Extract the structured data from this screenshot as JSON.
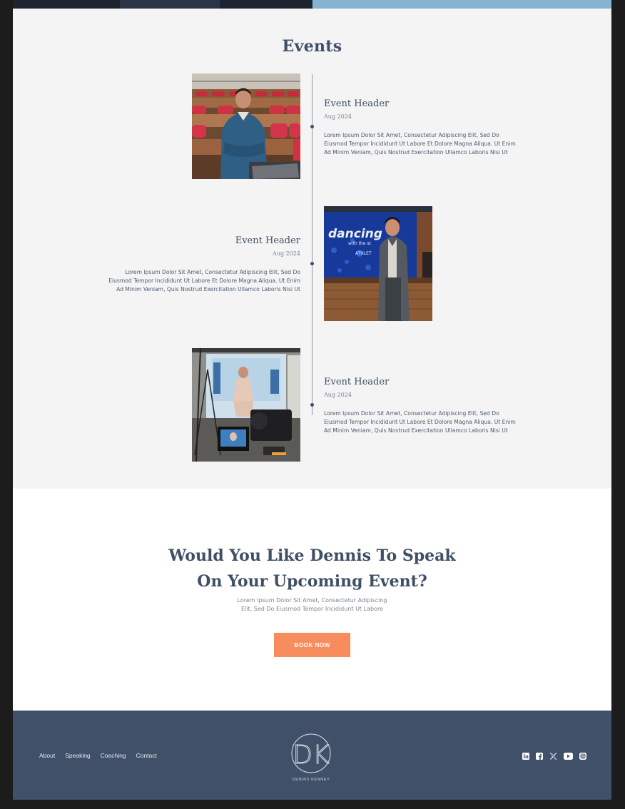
{
  "events": {
    "title": "Events",
    "items": [
      {
        "header": "Event Header",
        "date": "Aug 2024",
        "body_lines": [
          "Lorem Ipsum Dolor Sit Amet, Consectetur Adipiscing Elit, Sed Do",
          "Eiusmod Tempor Incididunt Ut Labore Et Dolore Magna Aliqua. Ut Enim",
          "Ad Minim Veniam, Quis Nostrud Exercitation Ullamco Laboris Nisi Ut"
        ]
      },
      {
        "header": "Event Header",
        "date": "Aug 2024",
        "body_lines": [
          "Lorem Ipsum Dolor Sit Amet, Consectetur Adipiscing Elit, Sed Do",
          "Eiusmod Tempor Incididunt Ut Labore Et Dolore Magna Aliqua. Ut Enim",
          "Ad Minim Veniam, Quis Nostrud Exercitation Ullamco Laboris Nisi Ut"
        ]
      },
      {
        "header": "Event Header",
        "date": "Aug 2024",
        "body_lines": [
          "Lorem Ipsum Dolor Sit Amet, Consectetur Adipiscing Elit, Sed Do",
          "Eiusmod Tempor Incididunt Ut Labore Et Dolore Magna Aliqua. Ut Enim",
          "Ad Minim Veniam, Quis Nostrud Exercitation Ullamco Laboris Nisi Ut"
        ]
      }
    ],
    "tv_logo_text": "dancing",
    "tv_logo_text_2": "with the st",
    "tv_logo_text_3": "ATHLET"
  },
  "cta": {
    "title_line1": "Would You Like Dennis To Speak",
    "title_line2": "On Your Upcoming Event?",
    "sub_line1": "Lorem Ipsum Dolor Sit Amet, Consectetur Adipiscing",
    "sub_line2": "Elit, Sed Do Eiusmod Tempor Incididunt Ut Labore",
    "button_label": "BOOK NOW"
  },
  "footer": {
    "nav": [
      "About",
      "Speaking",
      "Coaching",
      "Contact"
    ],
    "logo_letters": "DK",
    "logo_name": "DENNIS KENNEY",
    "socials": [
      "linkedin-icon",
      "facebook-icon",
      "x-icon",
      "youtube-icon",
      "instagram-icon"
    ]
  },
  "colors": {
    "accent": "#f78c5d",
    "navy": "#3f5068",
    "heading": "#3f4f66",
    "band_blue": "#86b3d1"
  }
}
